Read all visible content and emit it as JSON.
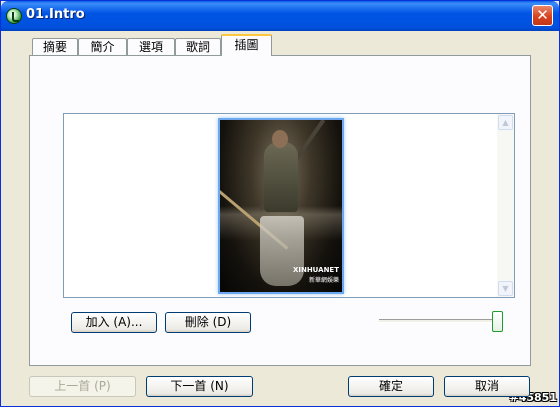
{
  "window": {
    "title": "01.Intro",
    "close_glyph": "✕"
  },
  "tabs": [
    {
      "label": "摘要"
    },
    {
      "label": "簡介"
    },
    {
      "label": "選項"
    },
    {
      "label": "歌詞"
    },
    {
      "label": "插圖",
      "active": true
    }
  ],
  "artwork": {
    "caption_line1": "XINHUANET",
    "caption_line2": "新華網娛樂"
  },
  "buttons": {
    "add": "加入 (A)...",
    "delete": "刪除 (D)",
    "previous": "上一首 (P)",
    "next": "下一首 (N)",
    "ok": "確定",
    "cancel": "取消"
  },
  "scrollbar": {
    "up_glyph": "▲",
    "down_glyph": "▼"
  },
  "slider": {
    "value": 1.0
  },
  "watermark": "#45851",
  "colors": {
    "titlebar": "#0055E5",
    "active_tab_accent": "#FFC83C",
    "slider_thumb": "#1F9A2E"
  }
}
